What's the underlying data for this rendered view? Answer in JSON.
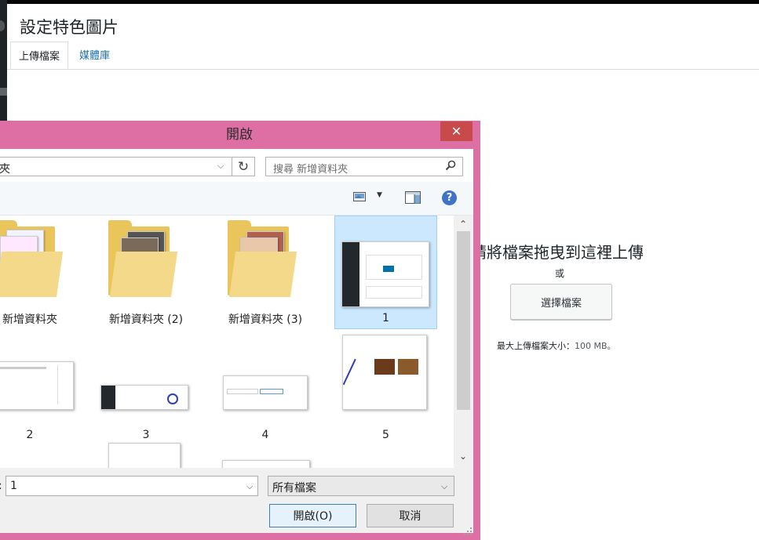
{
  "wp_modal": {
    "title": "設定特色圖片",
    "tabs": [
      {
        "label": "上傳檔案",
        "active": true
      },
      {
        "label": "媒體庫",
        "active": false
      }
    ],
    "drop_text": "請將檔案拖曳到這裡上傳",
    "or_text": "或",
    "select_button": "選擇檔案",
    "max_size_label": "最大上傳檔案大小：",
    "max_size_value": "100 MB。",
    "link_color": "#2271b1"
  },
  "open_dialog": {
    "title": "開啟",
    "address_text": "夾",
    "search_placeholder": "搜尋 新增資料夾",
    "items": [
      {
        "label": "新增資料夾",
        "kind": "folder"
      },
      {
        "label": "新增資料夾 (2)",
        "kind": "folder"
      },
      {
        "label": "新增資料夾 (3)",
        "kind": "folder"
      },
      {
        "label": "1",
        "kind": "image",
        "selected": true
      },
      {
        "label": "2",
        "kind": "image"
      },
      {
        "label": "3",
        "kind": "image"
      },
      {
        "label": "4",
        "kind": "image"
      },
      {
        "label": "5",
        "kind": "image"
      }
    ],
    "filename_label": ":",
    "filename_value": "1",
    "filetype_value": "所有檔案",
    "open_button": "開啟(O)",
    "cancel_button": "取消",
    "frame_color": "#dd6fa5",
    "close_color": "#c94a4a"
  }
}
